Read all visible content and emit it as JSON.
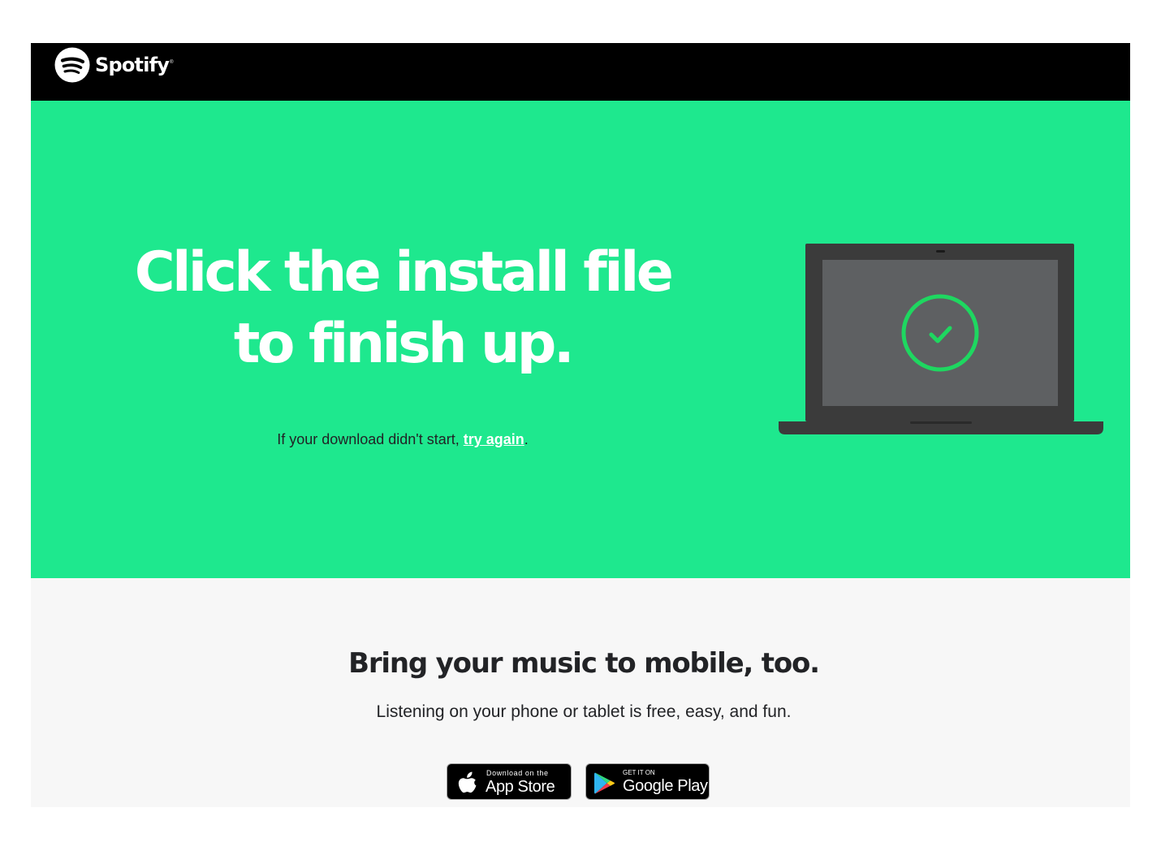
{
  "brand": {
    "name": "Spotify",
    "trademark": "®"
  },
  "colors": {
    "header_bg": "#000000",
    "hero_bg": "#1ee88e",
    "accent": "#1ed760",
    "mobile_bg": "#f7f7f7",
    "laptop_body": "#3b3b3b",
    "laptop_screen": "#5e6062"
  },
  "hero": {
    "title": "Click the install file to finish up.",
    "note_prefix": "If your download didn't start, ",
    "retry_link": "try again",
    "note_suffix": ".",
    "illustration": "laptop-checkmark"
  },
  "mobile": {
    "title": "Bring your music to mobile, too.",
    "subtitle": "Listening on your phone or tablet is free, easy, and fun.",
    "app_store": {
      "small": "Download on the",
      "big": "App Store",
      "icon": "apple-icon"
    },
    "google_play": {
      "small": "GET IT ON",
      "big": "Google Play",
      "icon": "google-play-icon"
    }
  }
}
